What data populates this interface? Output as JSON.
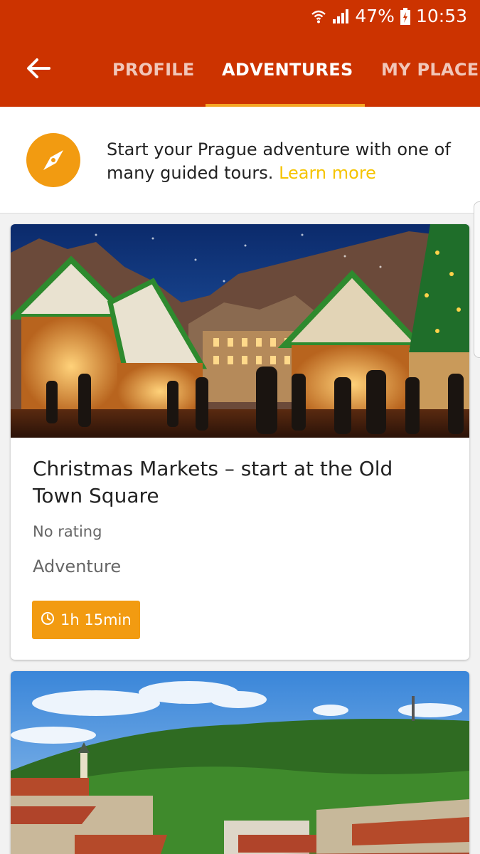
{
  "status_bar": {
    "battery": "47%",
    "time": "10:53"
  },
  "header": {
    "tabs": [
      {
        "label": "PROFILE"
      },
      {
        "label": "ADVENTURES"
      },
      {
        "label": "MY PLACES"
      }
    ],
    "active_tab": "ADVENTURES",
    "colors": {
      "background": "#cc3300",
      "indicator": "#f5a623"
    }
  },
  "banner": {
    "text": "Start your Prague adventure with one of many guided tours.",
    "link": "Learn more",
    "icon": "compass-icon"
  },
  "cards": [
    {
      "title": "Christmas Markets – start at the Old Town Square",
      "rating": "No rating",
      "category": "Adventure",
      "duration": "1h 15min"
    }
  ],
  "colors": {
    "accent": "#f29b11",
    "link": "#f5c400"
  }
}
